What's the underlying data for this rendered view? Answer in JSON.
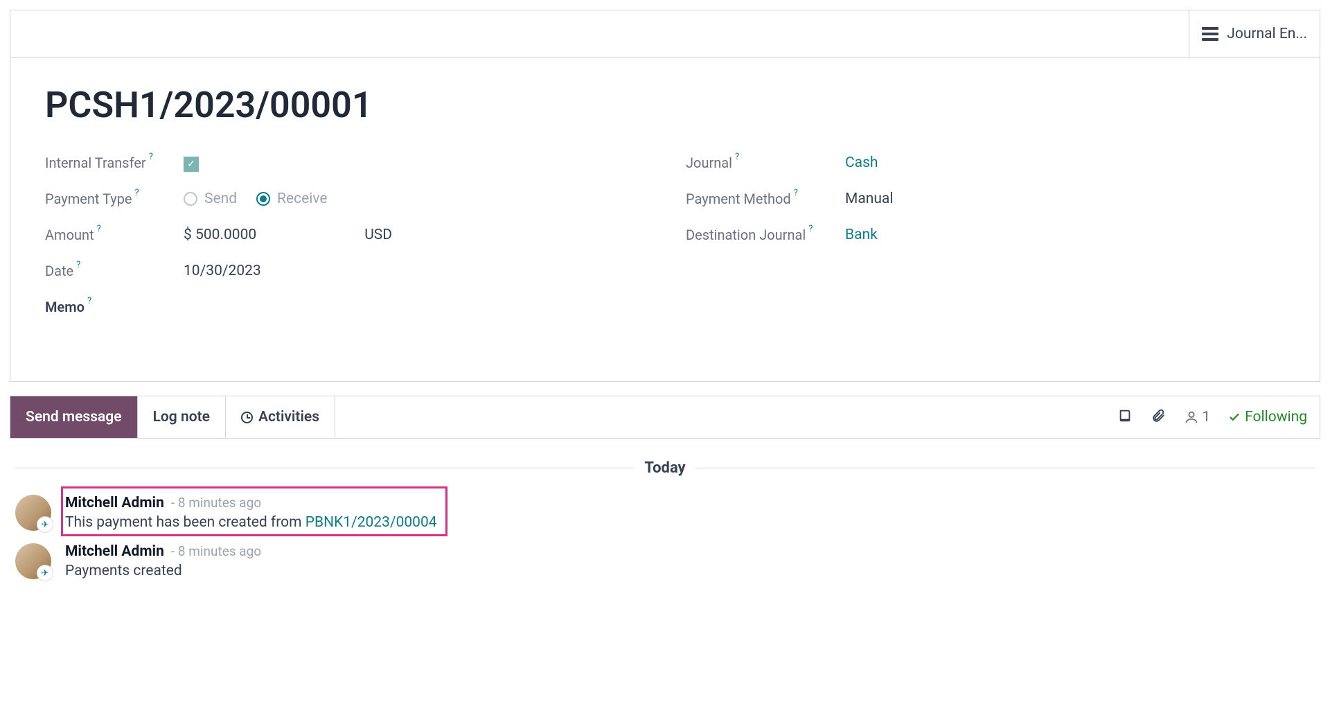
{
  "statButton": {
    "label": "Journal En..."
  },
  "record": {
    "title": "PCSH1/2023/00001",
    "internalTransferLabel": "Internal Transfer",
    "internalTransferChecked": true,
    "paymentTypeLabel": "Payment Type",
    "paymentType": {
      "send": "Send",
      "receive": "Receive",
      "selected": "receive"
    },
    "amountLabel": "Amount",
    "amountCurrencySymbol": "$",
    "amountValue": "500.0000",
    "amountCurrency": "USD",
    "dateLabel": "Date",
    "dateValue": "10/30/2023",
    "memoLabel": "Memo",
    "journalLabel": "Journal",
    "journalValue": "Cash",
    "paymentMethodLabel": "Payment Method",
    "paymentMethodValue": "Manual",
    "destJournalLabel": "Destination Journal",
    "destJournalValue": "Bank"
  },
  "chatter": {
    "sendMessage": "Send message",
    "logNote": "Log note",
    "activities": "Activities",
    "followerCount": "1",
    "following": "Following",
    "dateSeparator": "Today",
    "messages": [
      {
        "author": "Mitchell Admin",
        "time": "- 8 minutes ago",
        "text": "This payment has been created from ",
        "link": "PBNK1/2023/00004"
      },
      {
        "author": "Mitchell Admin",
        "time": "- 8 minutes ago",
        "text": "Payments created",
        "link": ""
      }
    ]
  }
}
